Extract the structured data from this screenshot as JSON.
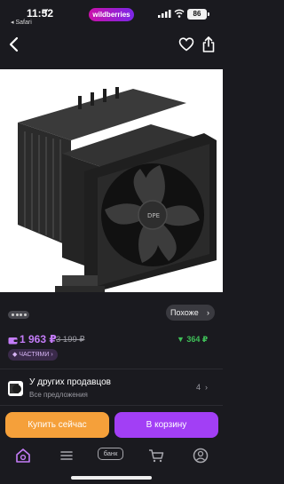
{
  "status_bar": {
    "time": "11:52",
    "back_app": "◂ Safari",
    "brand": "wildberries",
    "battery": "86"
  },
  "nav": {
    "back_icon": "chevron-left-icon",
    "favorite_icon": "heart-icon",
    "share_icon": "share-icon"
  },
  "gallery": {
    "pager_dots": 4,
    "similar_label": "Похоже",
    "similar_chevron": "›"
  },
  "price": {
    "current": "1 963 ₽",
    "old": "3 199 ₽",
    "cashback": "▼ 364 ₽",
    "installments": "◆ ЧАСТЯМИ ›",
    "accent_color": "#c47cf8",
    "cashback_color": "#3fbf58"
  },
  "sellers": {
    "title": "У других продавцов",
    "subtitle": "Все предложения",
    "count": "4",
    "chevron": "›"
  },
  "actions": {
    "buy_now": "Купить сейчас",
    "add_to_cart": "В корзину",
    "buy_color": "#f5a03a",
    "cart_color": "#a23ff5"
  },
  "tabbar": {
    "items": [
      "home-icon",
      "catalog-icon",
      "bank-icon",
      "cart-icon",
      "profile-icon"
    ],
    "bank_label": "банк"
  },
  "product_image": {
    "brand_label": "DPE"
  }
}
